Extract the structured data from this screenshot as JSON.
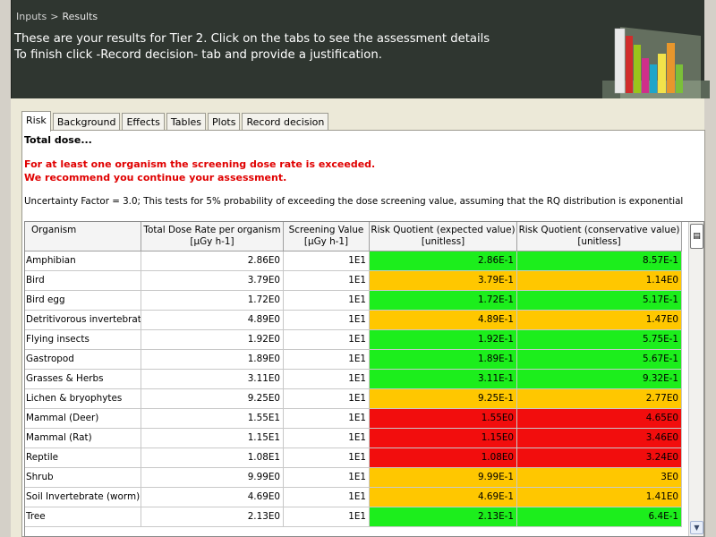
{
  "breadcrumb": {
    "inputs": "Inputs",
    "separator": ">",
    "current": "Results"
  },
  "header": {
    "line1": "These are your results for Tier 2. Click on the tabs to see the assessment details",
    "line2": "To finish click -Record decision- tab and provide a justification."
  },
  "tabs": [
    {
      "label": "Risk",
      "active": true
    },
    {
      "label": "Background",
      "active": false
    },
    {
      "label": "Effects",
      "active": false
    },
    {
      "label": "Tables",
      "active": false
    },
    {
      "label": "Plots",
      "active": false
    },
    {
      "label": "Record decision",
      "active": false
    }
  ],
  "risk": {
    "title": "Total dose...",
    "warning1": "For at least one organism the screening dose rate is exceeded.",
    "warning2": "We recommend you continue your assessment.",
    "uncertainty": "Uncertainty Factor = 3.0; This tests for 5% probability of exceeding the dose screening value, assuming that the RQ distribution is exponential"
  },
  "table": {
    "columns": [
      {
        "line1": "Organism",
        "line2": ""
      },
      {
        "line1": "Total Dose Rate per organism",
        "line2": "[µGy h-1]"
      },
      {
        "line1": "Screening Value",
        "line2": "[µGy h-1]"
      },
      {
        "line1": "Risk Quotient (expected value)",
        "line2": "[unitless]"
      },
      {
        "line1": "Risk Quotient (conservative value)",
        "line2": "[unitless]"
      }
    ],
    "rows": [
      {
        "organism": "Amphibian",
        "dose": "2.86E0",
        "screen": "1E1",
        "rq_exp": "2.86E-1",
        "rq_exp_status": "green",
        "rq_cons": "8.57E-1",
        "rq_cons_status": "green"
      },
      {
        "organism": "Bird",
        "dose": "3.79E0",
        "screen": "1E1",
        "rq_exp": "3.79E-1",
        "rq_exp_status": "orange",
        "rq_cons": "1.14E0",
        "rq_cons_status": "orange"
      },
      {
        "organism": "Bird egg",
        "dose": "1.72E0",
        "screen": "1E1",
        "rq_exp": "1.72E-1",
        "rq_exp_status": "green",
        "rq_cons": "5.17E-1",
        "rq_cons_status": "green"
      },
      {
        "organism": "Detritivorous invertebrate",
        "dose": "4.89E0",
        "screen": "1E1",
        "rq_exp": "4.89E-1",
        "rq_exp_status": "orange",
        "rq_cons": "1.47E0",
        "rq_cons_status": "orange"
      },
      {
        "organism": "Flying insects",
        "dose": "1.92E0",
        "screen": "1E1",
        "rq_exp": "1.92E-1",
        "rq_exp_status": "green",
        "rq_cons": "5.75E-1",
        "rq_cons_status": "green"
      },
      {
        "organism": "Gastropod",
        "dose": "1.89E0",
        "screen": "1E1",
        "rq_exp": "1.89E-1",
        "rq_exp_status": "green",
        "rq_cons": "5.67E-1",
        "rq_cons_status": "green"
      },
      {
        "organism": "Grasses & Herbs",
        "dose": "3.11E0",
        "screen": "1E1",
        "rq_exp": "3.11E-1",
        "rq_exp_status": "green",
        "rq_cons": "9.32E-1",
        "rq_cons_status": "green"
      },
      {
        "organism": "Lichen & bryophytes",
        "dose": "9.25E0",
        "screen": "1E1",
        "rq_exp": "9.25E-1",
        "rq_exp_status": "orange",
        "rq_cons": "2.77E0",
        "rq_cons_status": "orange"
      },
      {
        "organism": "Mammal (Deer)",
        "dose": "1.55E1",
        "screen": "1E1",
        "rq_exp": "1.55E0",
        "rq_exp_status": "red",
        "rq_cons": "4.65E0",
        "rq_cons_status": "red"
      },
      {
        "organism": "Mammal (Rat)",
        "dose": "1.15E1",
        "screen": "1E1",
        "rq_exp": "1.15E0",
        "rq_exp_status": "red",
        "rq_cons": "3.46E0",
        "rq_cons_status": "red"
      },
      {
        "organism": "Reptile",
        "dose": "1.08E1",
        "screen": "1E1",
        "rq_exp": "1.08E0",
        "rq_exp_status": "red",
        "rq_cons": "3.24E0",
        "rq_cons_status": "red"
      },
      {
        "organism": "Shrub",
        "dose": "9.99E0",
        "screen": "1E1",
        "rq_exp": "9.99E-1",
        "rq_exp_status": "orange",
        "rq_cons": "3E0",
        "rq_cons_status": "orange"
      },
      {
        "organism": "Soil Invertebrate (worm)",
        "dose": "4.69E0",
        "screen": "1E1",
        "rq_exp": "4.69E-1",
        "rq_exp_status": "orange",
        "rq_cons": "1.41E0",
        "rq_cons_status": "orange"
      },
      {
        "organism": "Tree",
        "dose": "2.13E0",
        "screen": "1E1",
        "rq_exp": "2.13E-1",
        "rq_exp_status": "green",
        "rq_cons": "6.4E-1",
        "rq_cons_status": "green"
      }
    ]
  },
  "colors": {
    "green": "#1cee1c",
    "orange": "#ffc700",
    "red": "#f20d0d",
    "header_bg": "#2f3630",
    "warning_text": "#e00000"
  },
  "icons": {
    "logo": "bar-chart-logo",
    "column_chooser": "column-chooser-icon",
    "scroll_down": "scroll-down-arrow-icon"
  }
}
